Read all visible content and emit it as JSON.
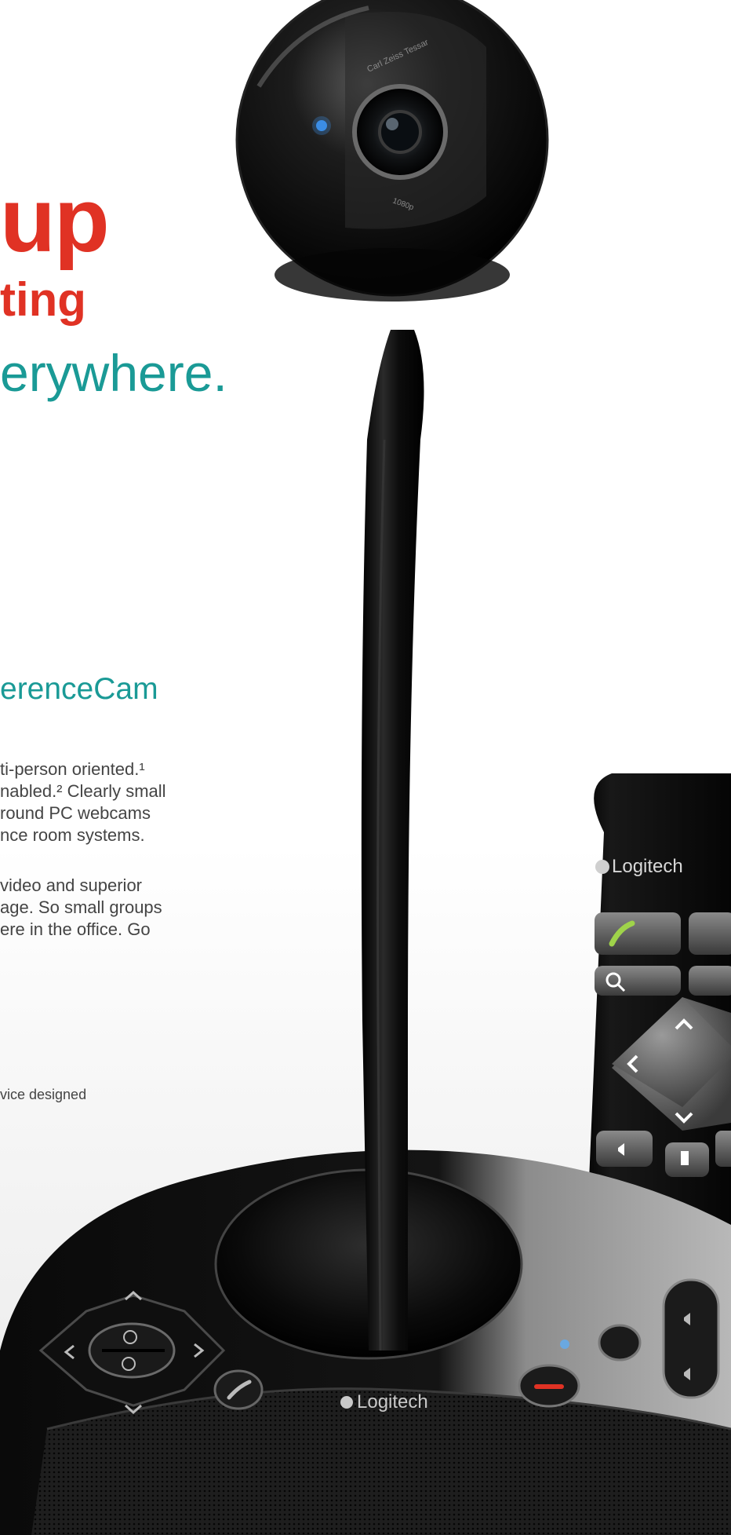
{
  "headline": {
    "line1": "up",
    "line2": "ting",
    "line3": "erywhere."
  },
  "product": {
    "name": "erenceCam",
    "paragraph1": [
      "ti-person oriented.¹",
      "nabled.² Clearly small",
      "round PC webcams",
      "nce room systems."
    ],
    "paragraph2": [
      "video and superior",
      "age. So small groups",
      "ere in the office. Go"
    ],
    "footnote": "vice designed"
  },
  "branding": {
    "base_logo": "Logitech",
    "remote_logo": "Logitech",
    "camera_label_1": "Carl Zeiss Tessar",
    "camera_label_2": "1080p"
  },
  "icons": [
    "logitech-logo-icon",
    "call-icon",
    "zoom-in-icon",
    "zoom-out-icon",
    "volume-icon",
    "mute-icon",
    "hang-up-icon"
  ],
  "colors": {
    "red": "#e03224",
    "teal": "#1a9a96",
    "device": "#0a0a0a"
  }
}
